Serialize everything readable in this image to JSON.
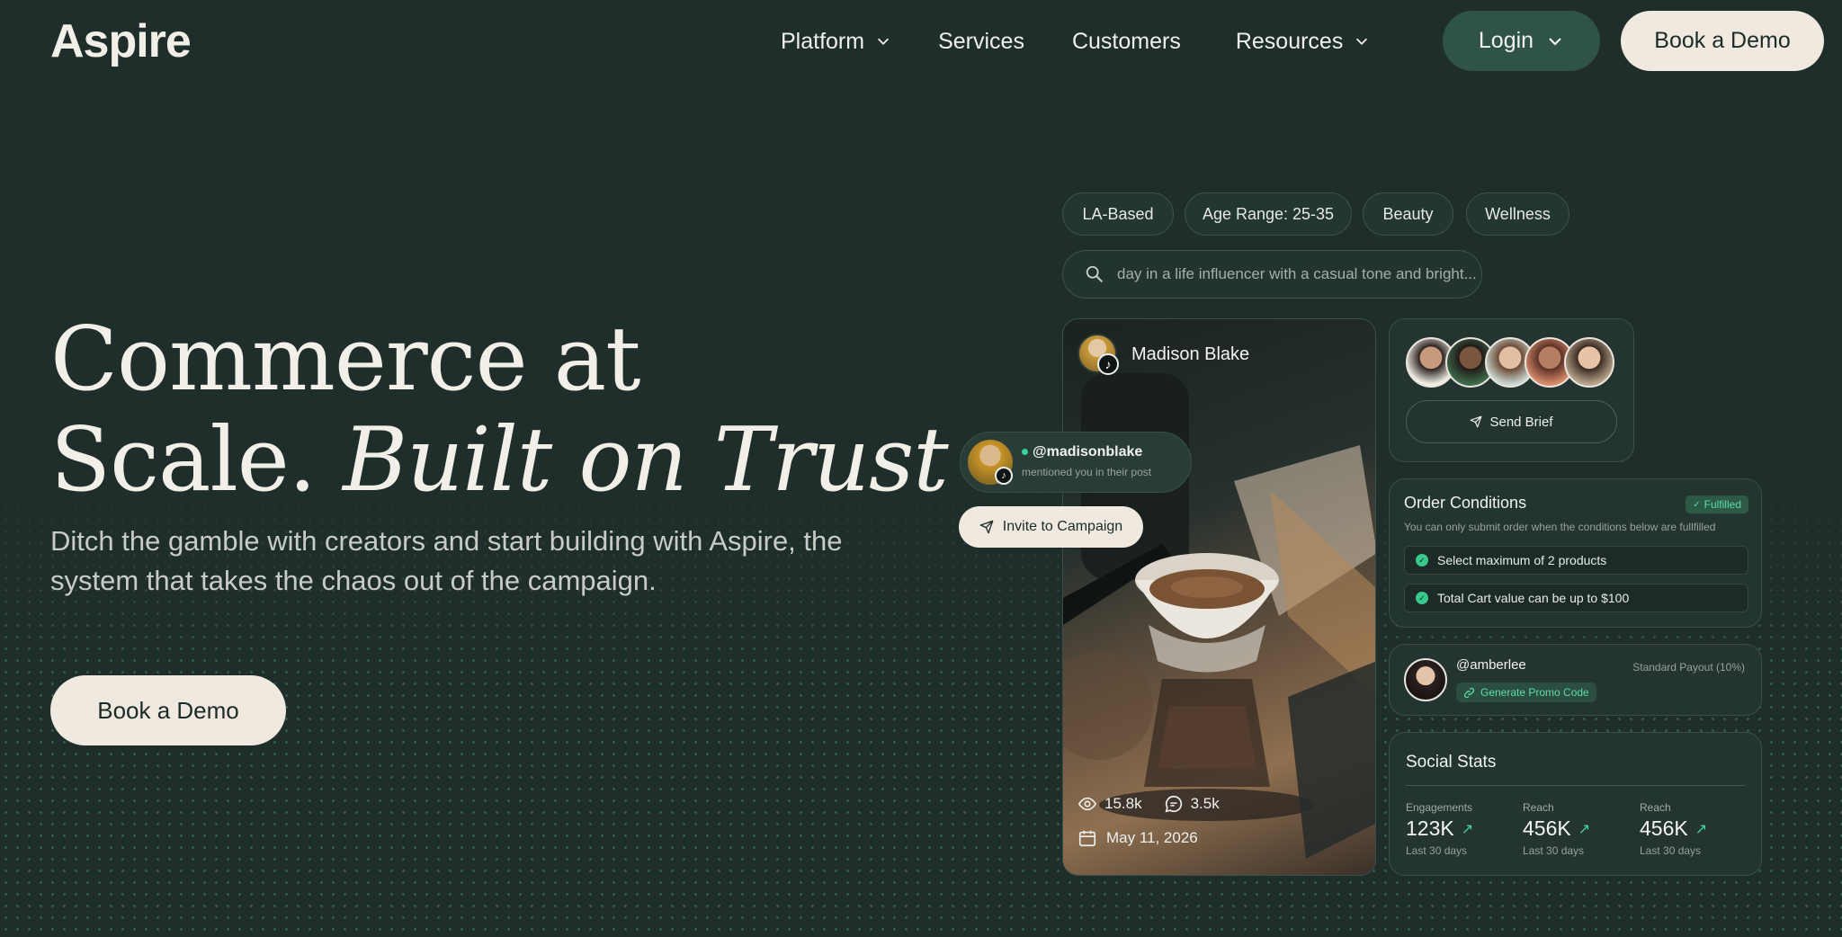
{
  "header": {
    "logo": "Aspire",
    "nav": [
      {
        "label": "Platform",
        "has_dropdown": true
      },
      {
        "label": "Services",
        "has_dropdown": false
      },
      {
        "label": "Customers",
        "has_dropdown": false
      },
      {
        "label": "Resources",
        "has_dropdown": true
      }
    ],
    "login_label": "Login",
    "demo_label": "Book a Demo"
  },
  "hero": {
    "title_line1": "Commerce at",
    "title_line2_plain": "Scale.",
    "title_line2_italic": "Built on Trust",
    "subtitle": "Ditch the gamble with creators and start building with Aspire, the system that takes the chaos out of the campaign.",
    "cta_label": "Book a Demo"
  },
  "filters": {
    "chips": [
      "LA-Based",
      "Age Range: 25-35",
      "Beauty",
      "Wellness"
    ],
    "search_text": "day in a life influencer with a casual tone and bright..."
  },
  "creator_card": {
    "name": "Madison Blake",
    "views": "15.8k",
    "comments": "3.5k",
    "date": "May 11, 2026"
  },
  "mention": {
    "handle": "@madisonblake",
    "subtext": "mentioned you in their post",
    "invite_label": "Invite to Campaign"
  },
  "brief": {
    "send_label": "Send Brief"
  },
  "order": {
    "title": "Order Conditions",
    "status": "Fulfilled",
    "description": "You can only submit order when the conditions below are fullfilled",
    "conditions": [
      "Select maximum of 2 products",
      "Total Cart value can be up to $100"
    ]
  },
  "payout": {
    "handle": "@amberlee",
    "label": "Standard Payout (10%)",
    "promo_label": "Generate Promo Code"
  },
  "social": {
    "title": "Social Stats",
    "stats": [
      {
        "label": "Engagements",
        "value": "123K",
        "period": "Last 30 days"
      },
      {
        "label": "Reach",
        "value": "456K",
        "period": "Last 30 days"
      },
      {
        "label": "Reach",
        "value": "456K",
        "period": "Last 30 days"
      }
    ]
  },
  "colors": {
    "background": "#1f2e2b",
    "cream": "#efe9e0",
    "accent_green": "#45d59a",
    "login_bg": "#2f5347"
  }
}
